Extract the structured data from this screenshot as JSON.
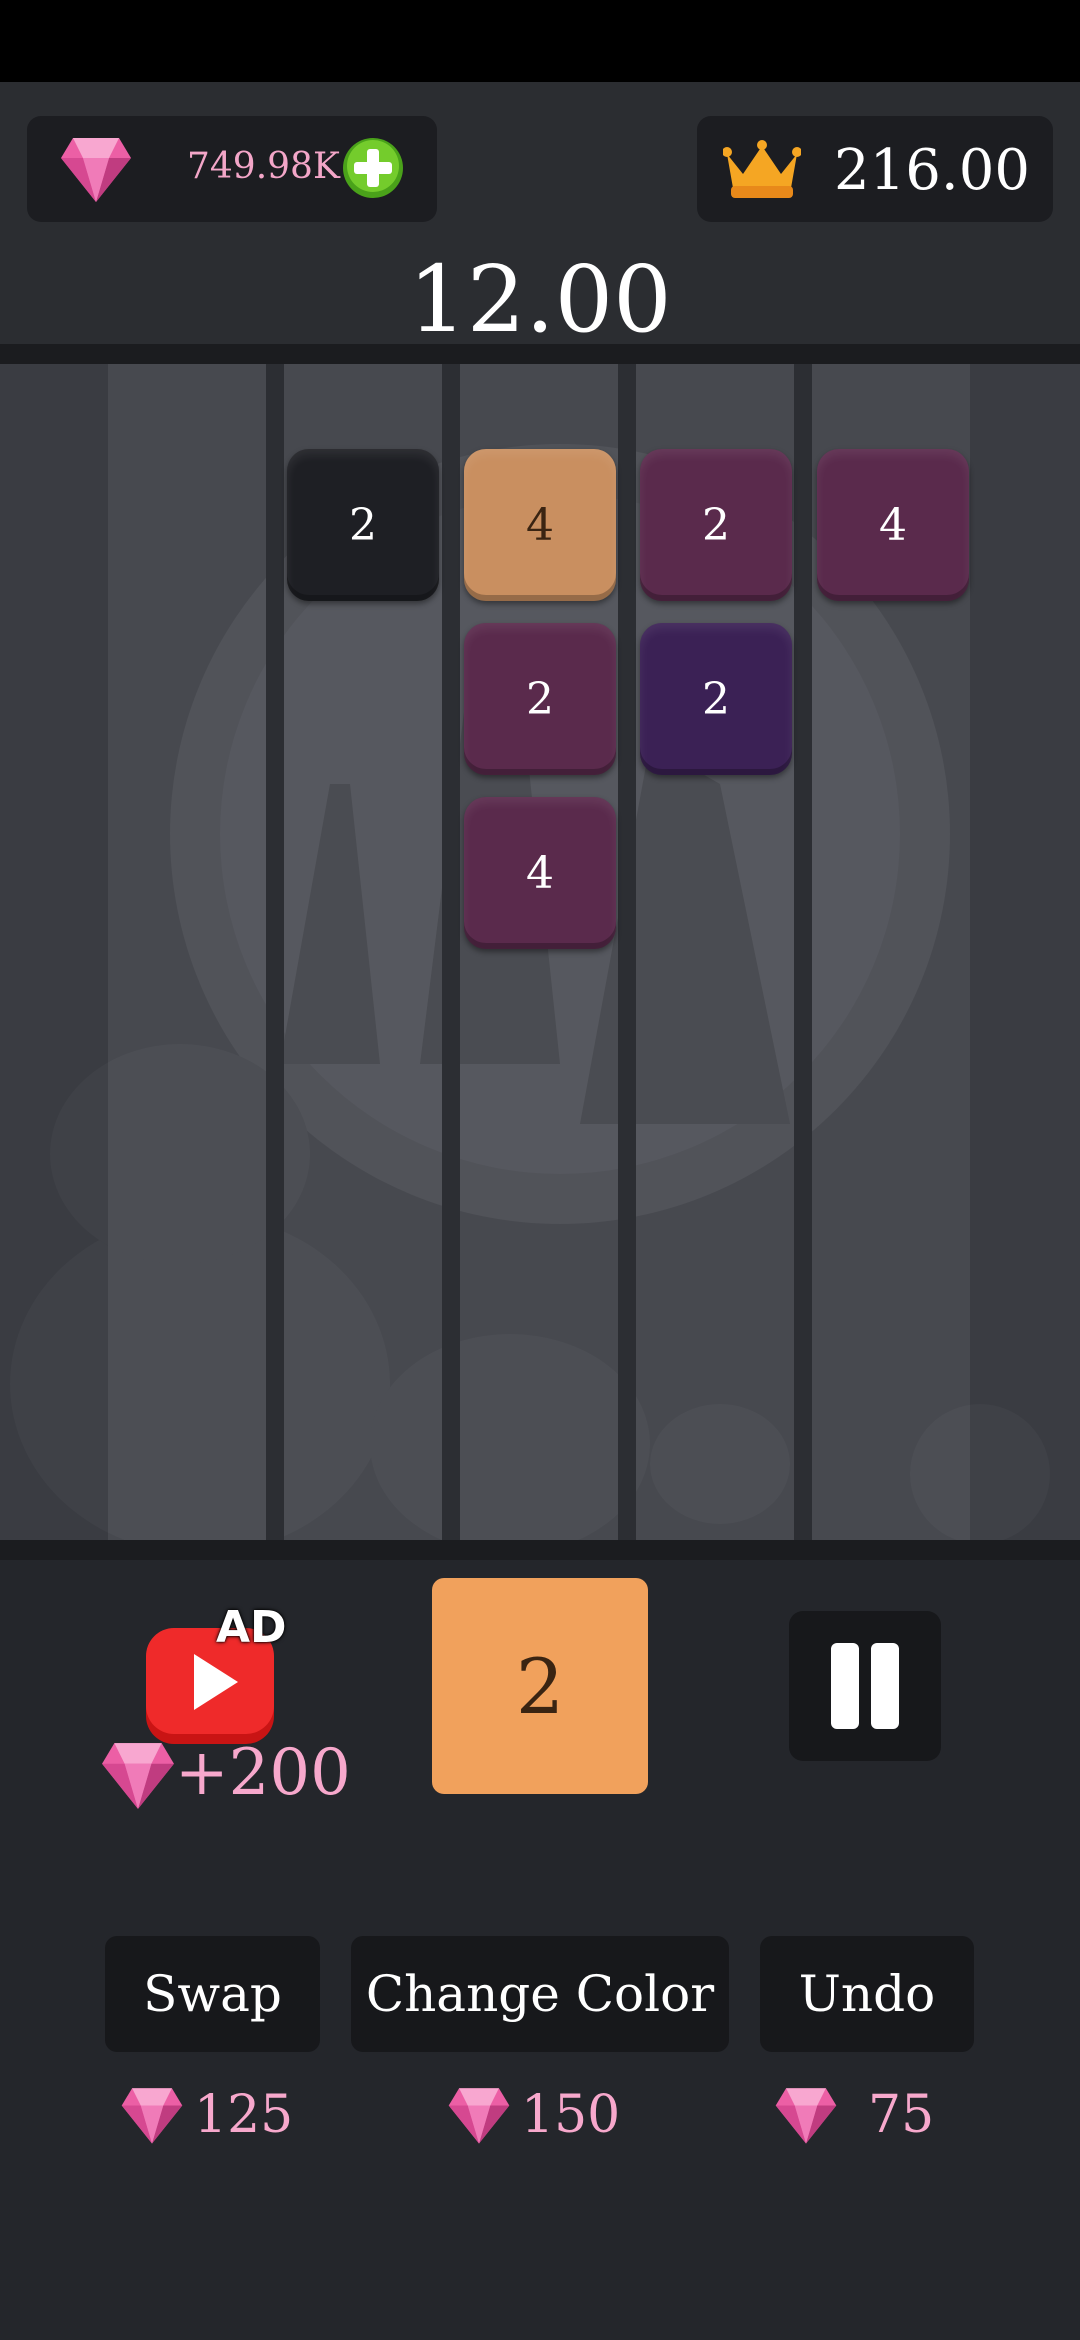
{
  "header": {
    "gems": "749.98K",
    "best_score": "216.00",
    "score": "12.00"
  },
  "board": {
    "columns": 5,
    "tiles": [
      {
        "col": 1,
        "row": 0,
        "value": "2",
        "color": "#1e1f24"
      },
      {
        "col": 2,
        "row": 0,
        "value": "4",
        "color": "#c98f60"
      },
      {
        "col": 2,
        "row": 1,
        "value": "2",
        "color": "#5a2a4c"
      },
      {
        "col": 2,
        "row": 2,
        "value": "4",
        "color": "#5a2a4c"
      },
      {
        "col": 3,
        "row": 0,
        "value": "2",
        "color": "#5a2a4c"
      },
      {
        "col": 3,
        "row": 1,
        "value": "2",
        "color": "#3b2155"
      },
      {
        "col": 4,
        "row": 0,
        "value": "4",
        "color": "#5a2a4c"
      }
    ]
  },
  "controls": {
    "ad_badge": "AD",
    "ad_reward": "+200",
    "next_tile": "2",
    "next_tile_color": "#f1a15c"
  },
  "actions": [
    {
      "label": "Swap",
      "cost": "125"
    },
    {
      "label": "Change Color",
      "cost": "150"
    },
    {
      "label": "Undo",
      "cost": "75"
    }
  ],
  "icons": {
    "gem": "pink-diamond-icon",
    "crown": "crown-icon",
    "plus": "plus-circle-icon",
    "ad": "video-ad-icon",
    "pause": "pause-icon"
  }
}
